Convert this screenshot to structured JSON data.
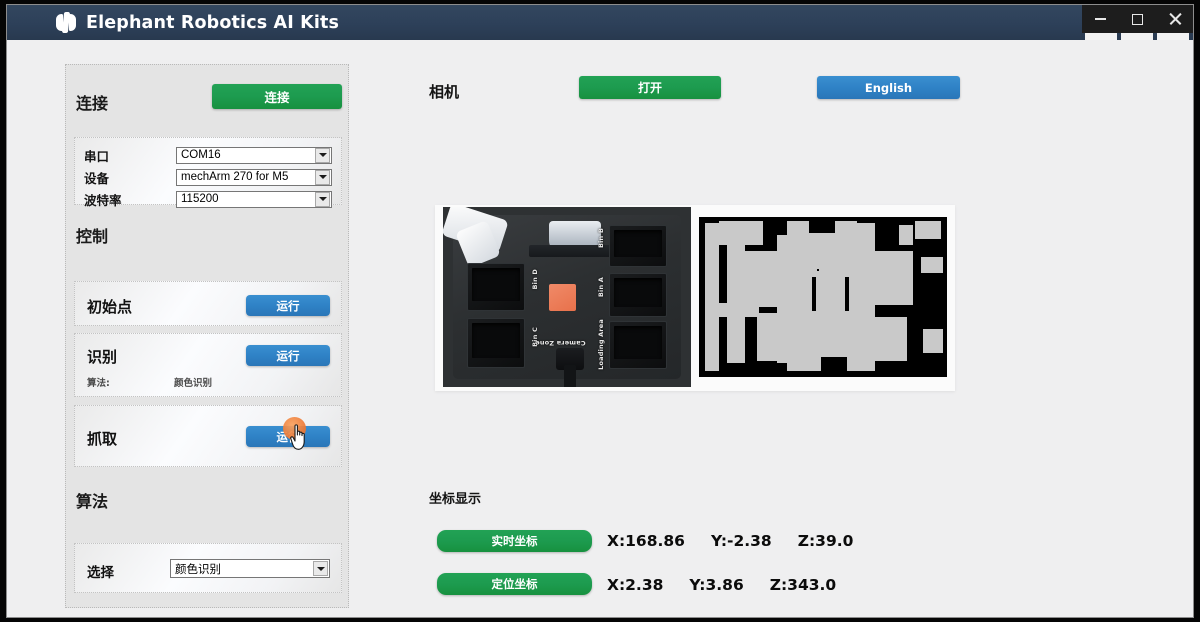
{
  "window": {
    "title": "Elephant Robotics AI Kits",
    "logo_icon": "elephant-logo-icon",
    "controls": {
      "minimize": "minimize-icon",
      "maximize": "maximize-icon",
      "close": "close-icon"
    }
  },
  "theme": {
    "titlebar": "#2d4059",
    "green": "#1d9b4f",
    "blue": "#2f82c6",
    "panel_bg": "#e4e4e4",
    "body_bg": "#efeff0",
    "cube_orange": "#e8714b"
  },
  "left_panel": {
    "connect": {
      "title": "连接",
      "button_label": "连接",
      "fields": [
        {
          "label": "串口",
          "value": "COM16"
        },
        {
          "label": "设备",
          "value": "mechArm 270 for M5"
        },
        {
          "label": "波特率",
          "value": "115200"
        }
      ]
    },
    "control": {
      "title": "控制",
      "actions": [
        {
          "name": "初始点",
          "button": "运行"
        },
        {
          "name": "识别",
          "button": "运行",
          "algo_label": "算法:",
          "algo_value": "颜色识别"
        },
        {
          "name": "抓取",
          "button": "运行"
        }
      ]
    },
    "algorithm": {
      "title": "算法",
      "select_label": "选择",
      "select_value": "颜色识别"
    }
  },
  "main": {
    "camera_label": "相机",
    "open_button": "打开",
    "language_button": "English",
    "camera_view": {
      "bins": [
        "Bin A",
        "Bin B",
        "Bin C",
        "Bin D"
      ],
      "zone_label": "Camera Zone",
      "loading_label": "Loading Area"
    },
    "coordinates": {
      "title": "坐标显示",
      "rows": [
        {
          "button": "实时坐标",
          "x": "X:168.86",
          "y": "Y:-2.38",
          "z": "Z:39.0"
        },
        {
          "button": "定位坐标",
          "x": "X:2.38",
          "y": "Y:3.86",
          "z": "Z:343.0"
        }
      ]
    }
  },
  "cursor": {
    "icon": "hand-pointer-cursor",
    "click_indicator": "click-highlight"
  }
}
